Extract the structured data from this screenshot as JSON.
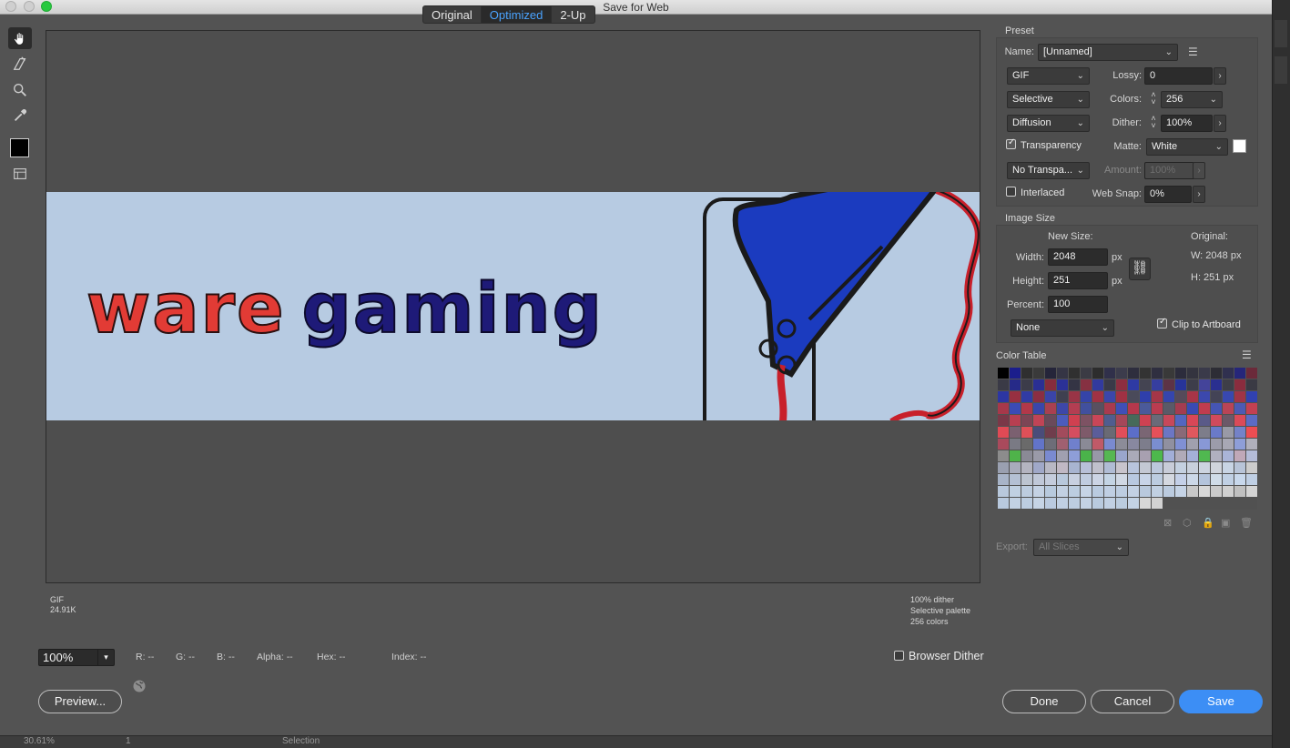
{
  "window": {
    "title": "Save for Web"
  },
  "tools": [
    "hand-tool-icon",
    "slice-select-tool-icon",
    "zoom-tool-icon",
    "eyedropper-tool-icon",
    "eyedropper-color-swatch",
    "toggle-slices-icon"
  ],
  "tabs": [
    {
      "label": "Original",
      "active": false
    },
    {
      "label": "Optimized",
      "active": true
    },
    {
      "label": "2-Up",
      "active": false
    }
  ],
  "canvas": {
    "banner_words": [
      "ware",
      "gaming"
    ],
    "info_left": {
      "format": "GIF",
      "size": "24.91K"
    },
    "info_right": {
      "line1": "100% dither",
      "line2": "Selective palette",
      "line3": "256 colors"
    }
  },
  "bottom": {
    "zoom": "100%",
    "readouts": {
      "r": "R: --",
      "g": "G: --",
      "b": "B: --",
      "alpha": "Alpha: --",
      "hex": "Hex: --",
      "index": "Index: --"
    },
    "browser_dither": "Browser Dither",
    "preview": "Preview...",
    "done": "Done",
    "cancel": "Cancel",
    "save": "Save"
  },
  "preset": {
    "title": "Preset",
    "name_label": "Name:",
    "name_value": "[Unnamed]",
    "format": "GIF",
    "lossy_label": "Lossy:",
    "lossy_value": "0",
    "reduction": "Selective",
    "colors_label": "Colors:",
    "colors_value": "256",
    "dither_algo": "Diffusion",
    "dither_label": "Dither:",
    "dither_value": "100%",
    "transparency": "Transparency",
    "transparency_checked": true,
    "matte_label": "Matte:",
    "matte_value": "White",
    "trans_dither": "No Transpa...",
    "amount_label": "Amount:",
    "amount_value": "100%",
    "interlaced": "Interlaced",
    "interlaced_checked": false,
    "websnap_label": "Web Snap:",
    "websnap_value": "0%"
  },
  "image_size": {
    "title": "Image Size",
    "new_size": "New Size:",
    "original": "Original:",
    "width_label": "Width:",
    "width_value": "2048",
    "height_label": "Height:",
    "height_value": "251",
    "px": "px",
    "percent_label": "Percent:",
    "percent_value": "100",
    "orig_w": "W:  2048 px",
    "orig_h": "H:   251 px",
    "quality": "None",
    "clip": "Clip to Artboard",
    "clip_checked": true
  },
  "color_table": {
    "title": "Color Table",
    "colors": [
      "#000000",
      "#1b1e8c",
      "#2f2f2f",
      "#3a3a3a",
      "#25253a",
      "#353545",
      "#303030",
      "#3b3b44",
      "#2d2d2d",
      "#30304a",
      "#3c3c4c",
      "#2e2e3e",
      "#333333",
      "#2f2f40",
      "#393939",
      "#2c2c3c",
      "#34343f",
      "#3a3a4a",
      "#2d2d35",
      "#30304f",
      "#26267a",
      "#6b2a3a",
      "#3a3a46",
      "#262a88",
      "#3c3c4a",
      "#2a2f94",
      "#862c3c",
      "#2b3197",
      "#343444",
      "#863142",
      "#323a9e",
      "#3a3a48",
      "#8d2e40",
      "#2e3aa4",
      "#444452",
      "#363e9f",
      "#5d3346",
      "#27349a",
      "#3d3d4a",
      "#44449a",
      "#2a2f90",
      "#3e3e48",
      "#8a2c3e",
      "#3a3a44",
      "#2c36a3",
      "#973041",
      "#313ba4",
      "#8b2e42",
      "#3a44a8",
      "#3f4050",
      "#993446",
      "#3544a8",
      "#a03244",
      "#3b46aa",
      "#a03143",
      "#4a4a5a",
      "#2f3fab",
      "#a43648",
      "#3545ad",
      "#554a5a",
      "#a83547",
      "#3c48ad",
      "#434356",
      "#3848b0",
      "#9f3447",
      "#3141b0",
      "#a7384a",
      "#3b4bb5",
      "#b2384a",
      "#3a46ab",
      "#a94050",
      "#3d47a8",
      "#b33e52",
      "#41509e",
      "#595060",
      "#a93a4e",
      "#3f4fb7",
      "#b5384c",
      "#4b5a9a",
      "#bb3c50",
      "#5a5a68",
      "#a43c50",
      "#3a4ab4",
      "#c03c4e",
      "#4555b4",
      "#b94456",
      "#4c5ab4",
      "#c34052",
      "#7a3848",
      "#b83f51",
      "#7d4555",
      "#c04456",
      "#6a4a5a",
      "#4c5cbc",
      "#d04050",
      "#7d5263",
      "#c94658",
      "#505d8f",
      "#a54759",
      "#466a5a",
      "#cf4252",
      "#6a6a78",
      "#c7485a",
      "#5466c0",
      "#d84757",
      "#5a5a88",
      "#cf4a5c",
      "#6b5868",
      "#da4a58",
      "#5b6bc4",
      "#e04a55",
      "#7b6070",
      "#df5058",
      "#4a4c7a",
      "#6f3d4c",
      "#a24b5c",
      "#d44e60",
      "#7e5a6a",
      "#5b5d9a",
      "#6a6a74",
      "#e04e5a",
      "#5c6ec8",
      "#7a6674",
      "#e6505a",
      "#6c76c4",
      "#8a6a78",
      "#e0585e",
      "#7d7d8a",
      "#6a7ac9",
      "#999aa6",
      "#7482c8",
      "#ec4d52",
      "#a94a5c",
      "#7a7a84",
      "#6a6a6a",
      "#6274c9",
      "#6d6d78",
      "#a06070",
      "#7080cc",
      "#8a8a96",
      "#c05a68",
      "#7a8ad0",
      "#8c8c98",
      "#8888a0",
      "#7d7d8c",
      "#7a8ed0",
      "#9090a0",
      "#8090d4",
      "#a0a0ae",
      "#8898d6",
      "#9c9caa",
      "#a8a8b4",
      "#8e9ed8",
      "#b0b0bc",
      "#8c8c8c",
      "#4fb34a",
      "#8a8a96",
      "#9a9aa8",
      "#7a8ad0",
      "#a0a0b0",
      "#8e9ed8",
      "#4ab34a",
      "#9898a8",
      "#56b752",
      "#9aa6cc",
      "#aaaab8",
      "#a8a0b0",
      "#4db84c",
      "#a2aed8",
      "#b0aab8",
      "#a4b0d8",
      "#50b850",
      "#b0b0c0",
      "#aab4d8",
      "#c0a8b8",
      "#b4bcd8",
      "#9aa0b0",
      "#a8acbc",
      "#b4b4c0",
      "#a0a8c8",
      "#b8b8c4",
      "#c0b8c4",
      "#a8b4d0",
      "#b8c0d8",
      "#c0c0cc",
      "#b0bcd4",
      "#c8c4cc",
      "#b8c4dc",
      "#c4c8d4",
      "#bcc8dc",
      "#c8ccd8",
      "#c4d0e0",
      "#c8d0dc",
      "#ccd4e0",
      "#d0d4dc",
      "#c8d4e4",
      "#b8c4d8",
      "#cccccc",
      "#a8b4c8",
      "#b4c0d4",
      "#bcc4d0",
      "#c0c8d8",
      "#c4ccdc",
      "#b8c8dc",
      "#c8d0e0",
      "#c0cce0",
      "#ccd4e4",
      "#c4d4e4",
      "#d0d8e4",
      "#b8c8e0",
      "#c8d4e8",
      "#bccce0",
      "#d4d8e0",
      "#c4d0e8",
      "#ccd8e8",
      "#b4c4dc",
      "#d0dce8",
      "#c0d0e4",
      "#c8d8ec",
      "#bfcfe4",
      "#b8c8dc",
      "#c0d0e2",
      "#bcccdf",
      "#c4d2e4",
      "#b8cade",
      "#c2d0e2",
      "#bccde0",
      "#c6d4e6",
      "#bacbe0",
      "#c0cfe3",
      "#bdcde1",
      "#c3d1e4",
      "#b9c9dd",
      "#c1d0e2",
      "#bbcbdf",
      "#c5d3e5",
      "#c8c8c8",
      "#d8d8d8",
      "#cacaca",
      "#d0d0d0",
      "#c0c0c0",
      "#d4d4d4",
      "#b8c9de",
      "#c2d1e3",
      "#bccde1",
      "#c6d4e5",
      "#bacadf",
      "#c0cfe2",
      "#bdcde0",
      "#c4d2e4",
      "#b9cade",
      "#c1d0e3",
      "#bbccdf",
      "#c4d3e5",
      "#d8d8d8",
      "#d2d2d2"
    ]
  },
  "export": {
    "label": "Export:",
    "value": "All Slices"
  },
  "background_strip": {
    "zoom": "30.61%",
    "page": "1",
    "mode": "Selection"
  }
}
